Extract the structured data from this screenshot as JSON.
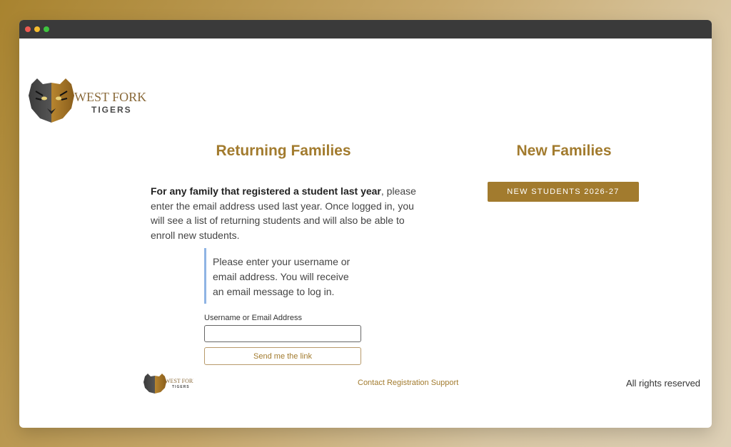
{
  "brand": {
    "logo_line1": "WEST FORK",
    "logo_line2": "TIGERS",
    "accent_color": "#a27b2e"
  },
  "returning": {
    "title": "Returning Families",
    "intro_bold": "For any family that registered a student last year",
    "intro_rest": ", please enter the email address used last year.  Once logged in, you will see a list of returning students and will also be able to enroll new students.",
    "notice": "Please enter your username or email address. You will receive an email message to log in.",
    "field_label": "Username or Email Address",
    "field_value": "",
    "send_button": "Send me the link"
  },
  "new_families": {
    "title": "New Families",
    "button": "NEW STUDENTS 2026-27"
  },
  "footer": {
    "contact_link": "Contact Registration Support",
    "rights": "All rights reserved"
  },
  "icons": {
    "logo": "tiger-head-icon",
    "window_controls": [
      "close-icon",
      "minimize-icon",
      "maximize-icon"
    ]
  }
}
